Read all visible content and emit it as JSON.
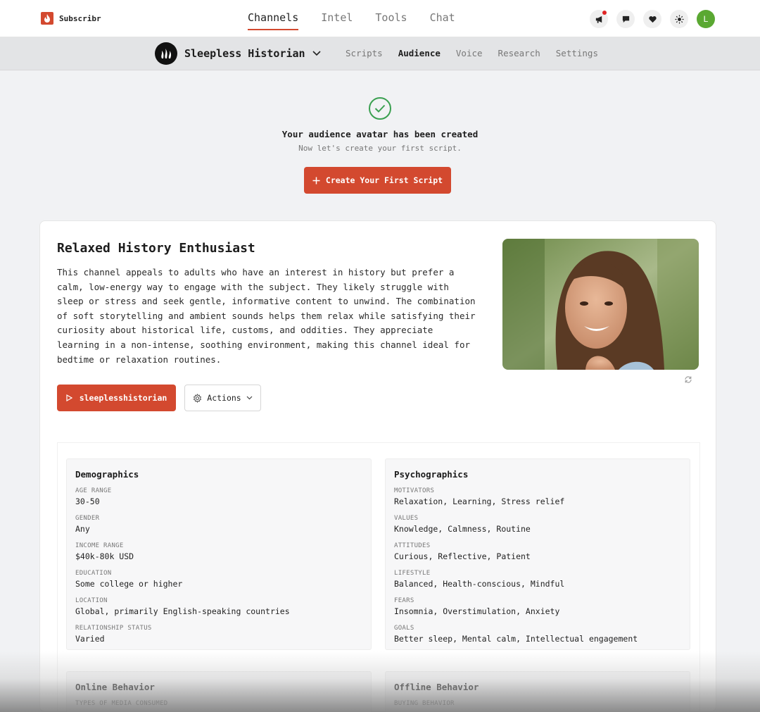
{
  "brand": {
    "name": "Subscribr",
    "logo_icon": "flame-icon",
    "accent": "#d3492f"
  },
  "main_nav": [
    {
      "label": "Channels",
      "active": true
    },
    {
      "label": "Intel",
      "active": false
    },
    {
      "label": "Tools",
      "active": false
    },
    {
      "label": "Chat",
      "active": false
    }
  ],
  "top_icons": [
    "megaphone-icon",
    "chat-icon",
    "heart-icon",
    "sun-icon"
  ],
  "user": {
    "initial": "L",
    "avatar_color": "#5aa832"
  },
  "channel": {
    "name": "Sleepless Historian",
    "logo_icon": "flames-icon"
  },
  "sub_nav": [
    {
      "label": "Scripts",
      "active": false
    },
    {
      "label": "Audience",
      "active": true
    },
    {
      "label": "Voice",
      "active": false
    },
    {
      "label": "Research",
      "active": false
    },
    {
      "label": "Settings",
      "active": false
    }
  ],
  "success": {
    "title": "Your audience avatar has been created",
    "subtitle": "Now let's create your first script.",
    "cta_label": "Create Your First Script"
  },
  "persona": {
    "title": "Relaxed History Enthusiast",
    "description": "This channel appeals to adults who have an interest in history but prefer a calm, low-energy way to engage with the subject. They likely struggle with sleep or stress and seek gentle, informative content to unwind. The combination of soft storytelling and ambient sounds helps them relax while satisfying their curiosity about historical life, customs, and oddities. They appreciate learning in a non-intense, soothing environment, making this channel ideal for bedtime or relaxation routines.",
    "youtube_label": "sleeplesshistorian",
    "actions_label": "Actions"
  },
  "demographics": {
    "title": "Demographics",
    "fields": [
      {
        "label": "Age Range",
        "value": "30-50"
      },
      {
        "label": "Gender",
        "value": "Any"
      },
      {
        "label": "Income Range",
        "value": "$40k-80k USD"
      },
      {
        "label": "Education",
        "value": "Some college or higher"
      },
      {
        "label": "Location",
        "value": "Global, primarily English-speaking countries"
      },
      {
        "label": "Relationship Status",
        "value": "Varied"
      }
    ]
  },
  "psychographics": {
    "title": "Psychographics",
    "fields": [
      {
        "label": "Motivators",
        "value": "Relaxation, Learning, Stress relief"
      },
      {
        "label": "Values",
        "value": "Knowledge, Calmness, Routine"
      },
      {
        "label": "Attitudes",
        "value": "Curious, Reflective, Patient"
      },
      {
        "label": "Lifestyle",
        "value": "Balanced, Health-conscious, Mindful"
      },
      {
        "label": "Fears",
        "value": "Insomnia, Overstimulation, Anxiety"
      },
      {
        "label": "Goals",
        "value": "Better sleep, Mental calm, Intellectual engagement"
      }
    ]
  },
  "online_behavior": {
    "title": "Online Behavior",
    "first_label": "Types of Media Consumed"
  },
  "offline_behavior": {
    "title": "Offline Behavior",
    "first_label": "Buying Behavior"
  }
}
